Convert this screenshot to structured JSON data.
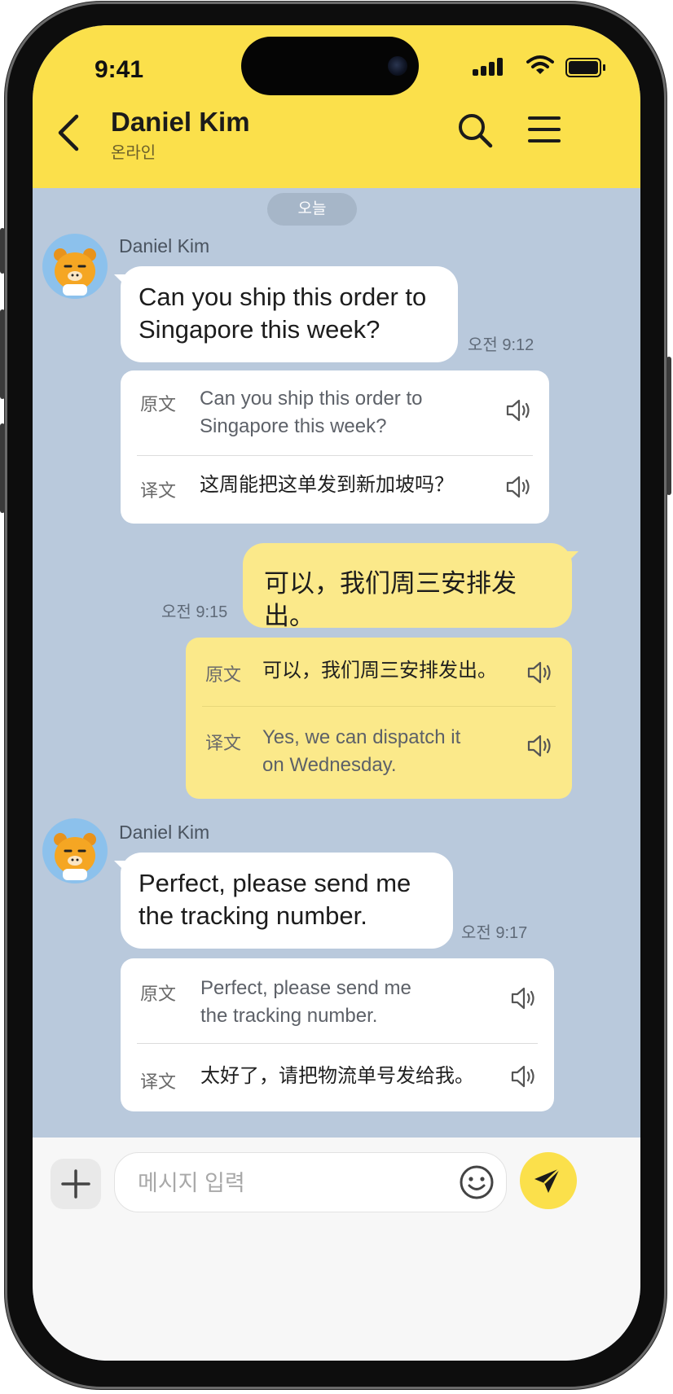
{
  "status_bar": {
    "time": "9:41"
  },
  "header": {
    "title": "Daniel Kim",
    "subtitle": "온라인"
  },
  "chat": {
    "date_divider": "오늘",
    "messages": [
      {
        "direction": "incoming",
        "sender": "Daniel Kim",
        "lines": [
          "Can you ship this order to",
          "Singapore this week?"
        ],
        "time": "오전 9:12",
        "translation": {
          "original_label": "原文",
          "original_lines": [
            "Can you ship this order to",
            "Singapore this week?"
          ],
          "translated_label": "译文",
          "translated_lines": [
            "这周能把这单发到新加坡吗？"
          ]
        }
      },
      {
        "direction": "outgoing",
        "lines": [
          "可以，我们周三安排发出。"
        ],
        "time": "오전 9:15",
        "translation": {
          "original_label": "原文",
          "original_lines": [
            "可以，我们周三安排发出。"
          ],
          "translated_label": "译文",
          "translated_lines": [
            "Yes, we can dispatch it",
            "on Wednesday."
          ]
        }
      },
      {
        "direction": "incoming",
        "sender": "Daniel Kim",
        "lines": [
          "Perfect, please send me",
          "the tracking number."
        ],
        "time": "오전 9:17",
        "translation": {
          "original_label": "原文",
          "original_lines": [
            "Perfect, please send me",
            "the tracking number."
          ],
          "translated_label": "译文",
          "translated_lines": [
            "太好了，请把物流单号发给我。"
          ]
        }
      }
    ]
  },
  "input": {
    "placeholder": "메시지 입력"
  },
  "icons": {
    "back": "chevron-left-icon",
    "search": "search-icon",
    "menu": "hamburger-menu-icon",
    "speaker": "speaker-icon",
    "plus": "plus-icon",
    "emoji": "smiley-icon",
    "send": "paper-plane-icon"
  },
  "colors": {
    "header_yellow": "#fbe04b",
    "chat_background": "#b9c9dc",
    "outgoing_bubble": "#fbe98a",
    "incoming_bubble": "#ffffff",
    "avatar_bg": "#8cc1ec"
  }
}
